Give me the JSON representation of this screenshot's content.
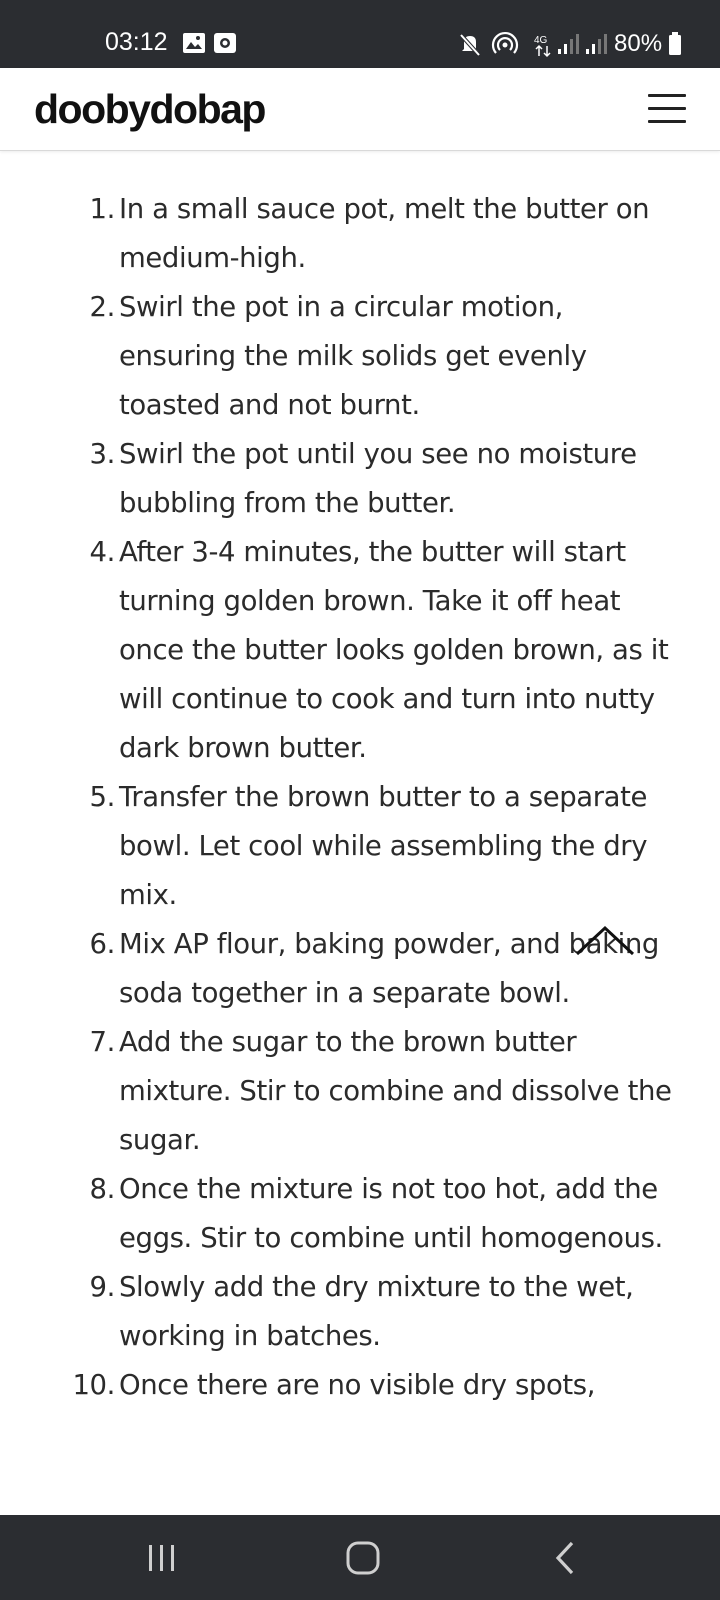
{
  "status_bar": {
    "time": "03:12",
    "battery": "80%",
    "icons": [
      "gallery-icon",
      "screen-record-icon",
      "mute-icon",
      "hotspot-icon",
      "4g-icon",
      "signal-icon",
      "signal-icon",
      "battery-icon"
    ]
  },
  "header": {
    "logo": "doobydobap",
    "menu_icon": "hamburger-menu-icon"
  },
  "steps": [
    {
      "num": "1.",
      "text": "In a small sauce pot, melt the butter on medium-high."
    },
    {
      "num": "2.",
      "text": "Swirl the pot in a circular motion, ensuring the milk solids get evenly toasted and not burnt."
    },
    {
      "num": "3.",
      "text": "Swirl the pot until you see no moisture bubbling from the butter."
    },
    {
      "num": "4.",
      "text": "After 3-4 minutes, the butter will start turning golden brown. Take it off heat once the butter looks golden brown, as it will continue to cook and turn into nutty dark brown butter."
    },
    {
      "num": "5.",
      "text": "Transfer the brown butter to a separate bowl. Let cool while assembling the dry mix."
    },
    {
      "num": "6.",
      "text": "Mix AP flour, baking powder, and baking soda together in a separate bowl."
    },
    {
      "num": "7.",
      "text": "Add the sugar to the brown butter mixture. Stir to combine and dissolve the sugar."
    },
    {
      "num": "8.",
      "text": "Once the mixture is not too hot, add the eggs. Stir to combine until homogenous."
    },
    {
      "num": "9.",
      "text": "Slowly add the dry mixture to the wet, working in batches."
    },
    {
      "num": "10.",
      "text": "Once there are no visible dry spots,"
    }
  ],
  "scroll_top_icon": "chevron-up-icon",
  "nav_bar": {
    "icons": [
      "recents-icon",
      "home-icon",
      "back-icon"
    ]
  },
  "colors": {
    "system_bar": "#2b2d31",
    "text": "#2b2b2b",
    "logo": "#111111"
  }
}
